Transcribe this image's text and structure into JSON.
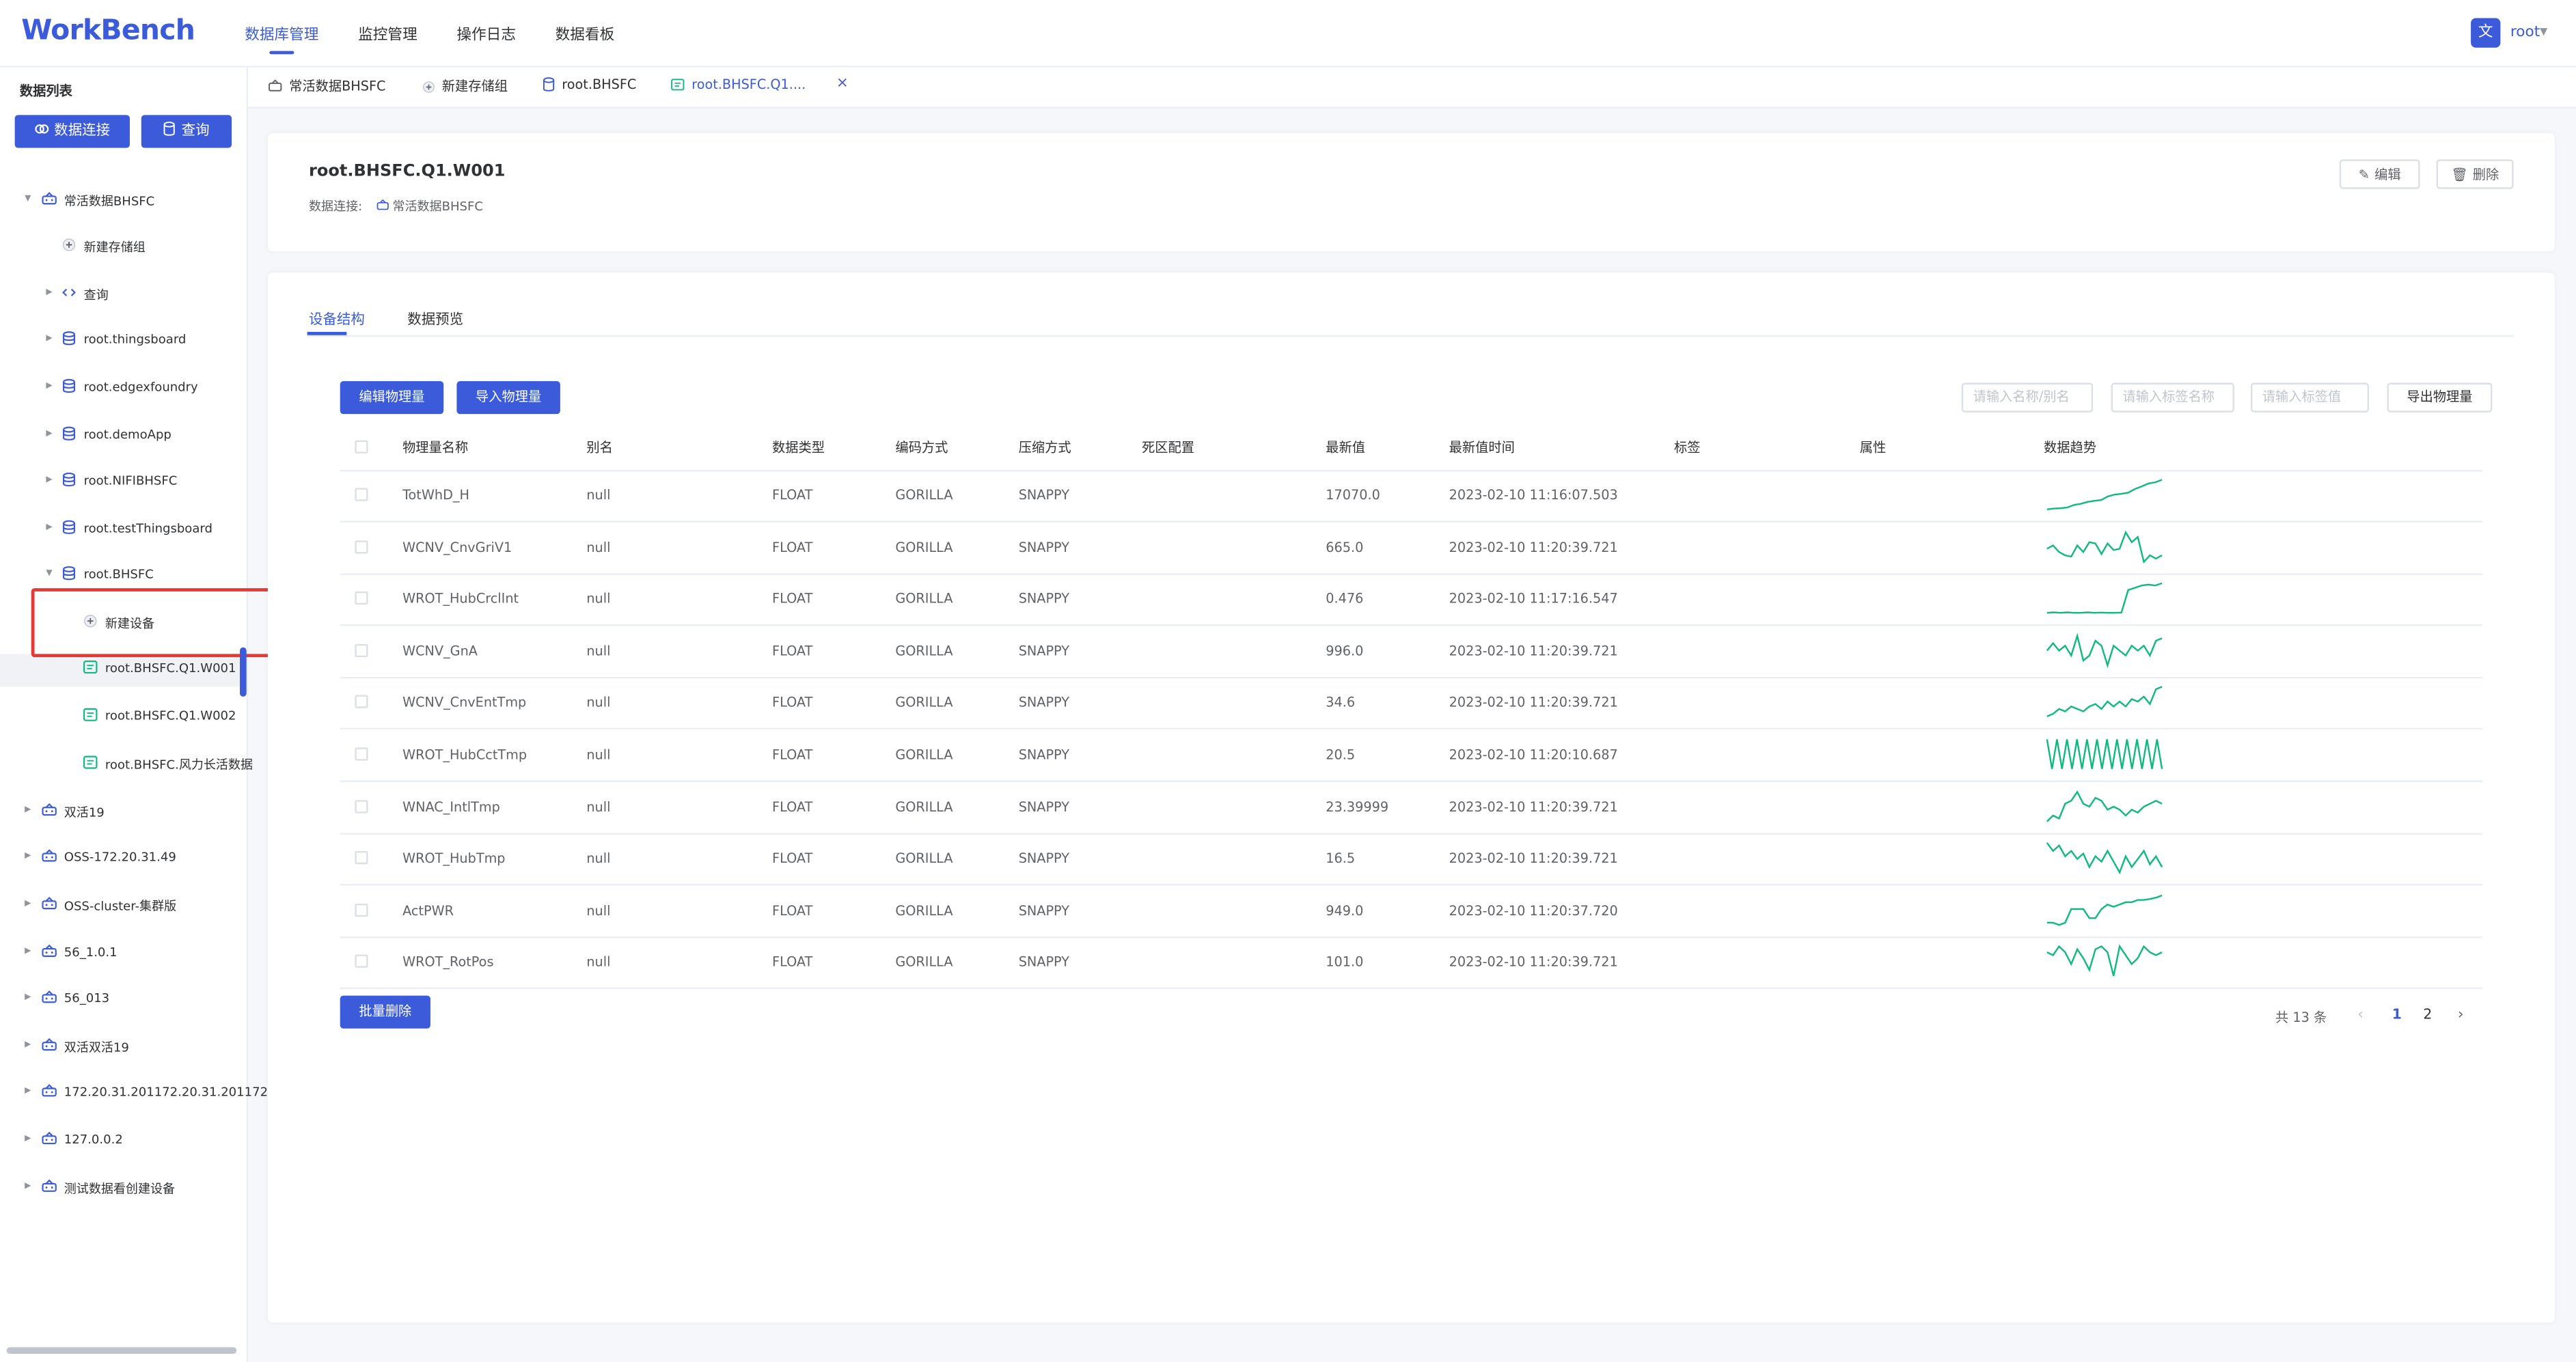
{
  "app": {
    "logo": "WorkBench",
    "nav": [
      "数据库管理",
      "监控管理",
      "操作日志",
      "数据看板"
    ],
    "active_nav": 0,
    "user": "root",
    "lang_icon_glyph": "文"
  },
  "sidebar": {
    "title": "数据列表",
    "connect_button": "数据连接",
    "query_button": "查询",
    "tree": [
      {
        "label": "常活数据BHSFC",
        "level": 0,
        "icon": "connection-icon",
        "expanded": true
      },
      {
        "label": "新建存储组",
        "level": 1,
        "icon": "add-icon"
      },
      {
        "label": "查询",
        "level": 1,
        "icon": "code-icon",
        "expandable": true
      },
      {
        "label": "root.thingsboard",
        "level": 1,
        "icon": "database-icon",
        "expandable": true
      },
      {
        "label": "root.edgexfoundry",
        "level": 1,
        "icon": "database-icon",
        "expandable": true
      },
      {
        "label": "root.demoApp",
        "level": 1,
        "icon": "database-icon",
        "expandable": true
      },
      {
        "label": "root.NIFIBHSFC",
        "level": 1,
        "icon": "database-icon",
        "expandable": true
      },
      {
        "label": "root.testThingsboard",
        "level": 1,
        "icon": "database-icon",
        "expandable": true
      },
      {
        "label": "root.BHSFC",
        "level": 1,
        "icon": "database-icon",
        "expanded": true
      },
      {
        "label": "新建设备",
        "level": 2,
        "icon": "add-icon"
      },
      {
        "label": "root.BHSFC.Q1.W001",
        "level": 2,
        "icon": "device-icon",
        "selected": true
      },
      {
        "label": "root.BHSFC.Q1.W002",
        "level": 2,
        "icon": "device-icon"
      },
      {
        "label": "root.BHSFC.风力长活数据",
        "level": 2,
        "icon": "device-icon"
      },
      {
        "label": "双活19",
        "level": 0,
        "icon": "connection-icon",
        "expandable": true
      },
      {
        "label": "OSS-172.20.31.49",
        "level": 0,
        "icon": "connection-icon",
        "expandable": true
      },
      {
        "label": "OSS-cluster-集群版",
        "level": 0,
        "icon": "connection-icon",
        "expandable": true
      },
      {
        "label": "56_1.0.1",
        "level": 0,
        "icon": "connection-icon",
        "expandable": true
      },
      {
        "label": "56_013",
        "level": 0,
        "icon": "connection-icon",
        "expandable": true
      },
      {
        "label": "双活双活19",
        "level": 0,
        "icon": "connection-icon",
        "expandable": true
      },
      {
        "label": "172.20.31.201172.20.31.201172.",
        "level": 0,
        "icon": "connection-icon",
        "expandable": true
      },
      {
        "label": "127.0.0.2",
        "level": 0,
        "icon": "connection-icon",
        "expandable": true
      },
      {
        "label": "测试数据看创建设备",
        "level": 0,
        "icon": "connection-icon",
        "expandable": true
      }
    ]
  },
  "tabs": [
    {
      "label": "常活数据BHSFC",
      "icon": "connection-icon"
    },
    {
      "label": "新建存储组",
      "icon": "add-icon"
    },
    {
      "label": "root.BHSFC",
      "icon": "database-icon"
    },
    {
      "label": "root.BHSFC.Q1....",
      "icon": "device-icon",
      "active": true,
      "closable": true
    }
  ],
  "device": {
    "title": "root.BHSFC.Q1.W001",
    "connection_label": "数据连接:",
    "connection_value": "常活数据BHSFC",
    "edit_button": "编辑",
    "delete_button": "删除"
  },
  "content_tabs": [
    "设备结构",
    "数据预览"
  ],
  "active_content_tab": 0,
  "toolbar": {
    "edit_measurements": "编辑物理量",
    "import_measurements": "导入物理量",
    "filter_name_placeholder": "请输入名称/别名",
    "filter_tag_name_placeholder": "请输入标签名称",
    "filter_tag_value_placeholder": "请输入标签值",
    "export_measurements": "导出物理量"
  },
  "table": {
    "columns": [
      "物理量名称",
      "别名",
      "数据类型",
      "编码方式",
      "压缩方式",
      "死区配置",
      "最新值",
      "最新值时间",
      "标签",
      "属性",
      "数据趋势"
    ],
    "rows": [
      {
        "name": "TotWhD_H",
        "alias": "null",
        "type": "FLOAT",
        "encoding": "GORILLA",
        "compression": "SNAPPY",
        "deadband": "",
        "latest": "17070.0",
        "time": "2023-02-10 11:16:07.503",
        "tags": "",
        "attrs": "",
        "trend": [
          1,
          1.2,
          1.3,
          1.5,
          2.2,
          2.5,
          3,
          3.3,
          3.5,
          4.5,
          5,
          5.2,
          5.5,
          6.5,
          7.2,
          8,
          8.3,
          9
        ]
      },
      {
        "name": "WCNV_CnvGriV1",
        "alias": "null",
        "type": "FLOAT",
        "encoding": "GORILLA",
        "compression": "SNAPPY",
        "deadband": "",
        "latest": "665.0",
        "time": "2023-02-10 11:20:39.721",
        "tags": "",
        "attrs": "",
        "trend": [
          5,
          5.5,
          4.5,
          4,
          3.8,
          5.5,
          4.5,
          6,
          5.8,
          4.2,
          5.8,
          4.8,
          5,
          7.5,
          6,
          6.8,
          3,
          4,
          3.5,
          4
        ]
      },
      {
        "name": "WROT_HubCrclInt",
        "alias": "null",
        "type": "FLOAT",
        "encoding": "GORILLA",
        "compression": "SNAPPY",
        "deadband": "",
        "latest": "0.476",
        "time": "2023-02-10 11:17:16.547",
        "tags": "",
        "attrs": "",
        "trend": [
          1,
          1.1,
          1,
          1.1,
          1,
          1,
          1.1,
          1,
          1.05,
          1,
          1,
          1.05,
          6,
          6.5,
          7,
          7.2,
          7,
          7.5
        ]
      },
      {
        "name": "WCNV_GnA",
        "alias": "null",
        "type": "FLOAT",
        "encoding": "GORILLA",
        "compression": "SNAPPY",
        "deadband": "",
        "latest": "996.0",
        "time": "2023-02-10 11:20:39.721",
        "tags": "",
        "attrs": "",
        "trend": [
          4,
          5.5,
          4,
          5,
          3,
          7,
          2,
          3,
          6,
          5,
          1,
          5,
          4,
          3,
          5,
          4,
          5,
          3,
          6,
          6.5
        ]
      },
      {
        "name": "WCNV_CnvEntTmp",
        "alias": "null",
        "type": "FLOAT",
        "encoding": "GORILLA",
        "compression": "SNAPPY",
        "deadband": "",
        "latest": "34.6",
        "time": "2023-02-10 11:20:39.721",
        "tags": "",
        "attrs": "",
        "trend": [
          2,
          2.5,
          3.5,
          3,
          4,
          3.5,
          3,
          4,
          4.5,
          3.5,
          5,
          4,
          5,
          4,
          5.5,
          5,
          6,
          4.5,
          7.5,
          8
        ]
      },
      {
        "name": "WROT_HubCctTmp",
        "alias": "null",
        "type": "FLOAT",
        "encoding": "GORILLA",
        "compression": "SNAPPY",
        "deadband": "",
        "latest": "20.5",
        "time": "2023-02-10 11:20:10.687",
        "tags": "",
        "attrs": "",
        "trend": [
          8,
          1,
          8,
          1,
          8,
          1,
          8,
          1,
          8,
          1,
          8,
          1,
          8,
          1,
          8,
          1,
          8,
          1,
          8,
          1,
          8,
          1,
          8,
          1
        ]
      },
      {
        "name": "WNAC_IntlTmp",
        "alias": "null",
        "type": "FLOAT",
        "encoding": "GORILLA",
        "compression": "SNAPPY",
        "deadband": "",
        "latest": "23.39999",
        "time": "2023-02-10 11:20:39.721",
        "tags": "",
        "attrs": "",
        "trend": [
          2,
          3,
          2.5,
          5,
          5.5,
          7,
          5,
          4.5,
          6,
          5.5,
          4,
          4.5,
          4,
          3,
          4,
          3.5,
          4.5,
          5,
          5.5,
          5
        ]
      },
      {
        "name": "WROT_HubTmp",
        "alias": "null",
        "type": "FLOAT",
        "encoding": "GORILLA",
        "compression": "SNAPPY",
        "deadband": "",
        "latest": "16.5",
        "time": "2023-02-10 11:20:39.721",
        "tags": "",
        "attrs": "",
        "trend": [
          7.5,
          6,
          7,
          5,
          6,
          4.5,
          5.5,
          3,
          5,
          4,
          6,
          4,
          2,
          5,
          3,
          4.5,
          6,
          3.5,
          5,
          3
        ]
      },
      {
        "name": "ActPWR",
        "alias": "null",
        "type": "FLOAT",
        "encoding": "GORILLA",
        "compression": "SNAPPY",
        "deadband": "",
        "latest": "949.0",
        "time": "2023-02-10 11:20:37.720",
        "tags": "",
        "attrs": "",
        "trend": [
          2,
          2,
          1.5,
          2,
          5,
          5,
          5,
          3,
          3,
          5,
          6,
          5.5,
          6,
          6.5,
          6.5,
          7,
          7,
          7.2,
          7.5,
          8
        ]
      },
      {
        "name": "WROT_RotPos",
        "alias": "null",
        "type": "FLOAT",
        "encoding": "GORILLA",
        "compression": "SNAPPY",
        "deadband": "",
        "latest": "101.0",
        "time": "2023-02-10 11:20:39.721",
        "tags": "",
        "attrs": "",
        "trend": [
          6,
          5.5,
          7,
          6,
          4,
          6.5,
          5,
          3,
          6.5,
          7,
          6,
          2,
          7,
          5.5,
          4,
          5,
          7,
          6,
          5.5,
          6
        ]
      }
    ]
  },
  "footer": {
    "bulk_delete": "批量删除",
    "total_text": "共 13 条",
    "pages": [
      "1",
      "2"
    ],
    "current_page": "1"
  },
  "colors": {
    "primary": "#3b5bdb",
    "spark": "#10b981",
    "highlight": "#e53935"
  }
}
